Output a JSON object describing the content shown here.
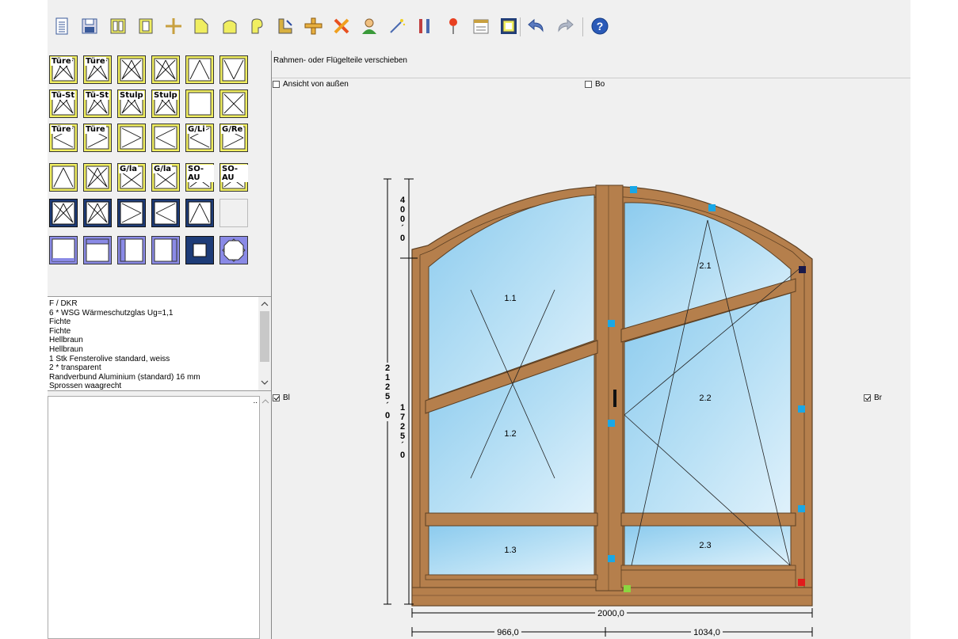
{
  "toolbar": {
    "icons": [
      "new-document",
      "save",
      "frame-layout",
      "frame",
      "mullion",
      "shape-triangle",
      "shape-arch",
      "shape-round",
      "move-tool",
      "cross-bar",
      "delete",
      "user",
      "magic-wand",
      "tools",
      "pin",
      "calendar",
      "frame-select",
      "undo",
      "redo",
      "help"
    ]
  },
  "palette": {
    "rows": [
      [
        "Türe",
        "Türe",
        "",
        "",
        "",
        ""
      ],
      [
        "Tü-St",
        "Tü-St",
        "Stulp",
        "Stulp",
        "",
        ""
      ],
      [
        "Türe",
        "Türe",
        "",
        "",
        "G/Li",
        "G/Re"
      ],
      [
        "",
        "",
        "G/la",
        "G/la",
        "SO-AU",
        "SO-AU"
      ]
    ]
  },
  "info": {
    "lines": [
      "F / DKR",
      "6 * WSG Wärmeschutzglas Ug=1,1",
      "Fichte",
      "Fichte",
      "Hellbraun",
      "Hellbraun",
      "1 Stk Fensterolive standard, weiss",
      "2 * transparent",
      "Randverbund Aluminium (standard) 16 mm",
      "Sprossen waagrecht"
    ]
  },
  "lower_panel": {
    "dots": ".."
  },
  "header": {
    "label": "Rahmen- oder Flügelteile verschieben"
  },
  "checkboxes": {
    "view_outside": {
      "label": "Ansicht von außen",
      "checked": false
    },
    "bo": {
      "label": "Bo",
      "checked": false
    },
    "bl": {
      "label": "Bl",
      "checked": true
    },
    "br": {
      "label": "Br",
      "checked": true
    }
  },
  "window": {
    "panes": [
      "1.1",
      "1.2",
      "1.3",
      "2.1",
      "2.2",
      "2.3"
    ],
    "dim_top_arch": [
      "4",
      "0",
      "0",
      "´",
      "0"
    ],
    "dim_total_height": [
      "2",
      "1",
      "2",
      "5",
      "´",
      "0"
    ],
    "dim_lower_height": [
      "1",
      "7",
      "2",
      "5",
      "´",
      "0"
    ],
    "dim_width_total": "2000,0",
    "dim_width_left": "966,0",
    "dim_width_right": "1034,0"
  },
  "colors": {
    "frame": "#b57f4c",
    "frame_dark": "#6b4a2a",
    "glass": "#a7d7f1",
    "palette_yellow": "#f0ee60",
    "palette_navy": "#1e3c78",
    "palette_violet": "#8a8ae6",
    "handle": "#19a7e6"
  }
}
